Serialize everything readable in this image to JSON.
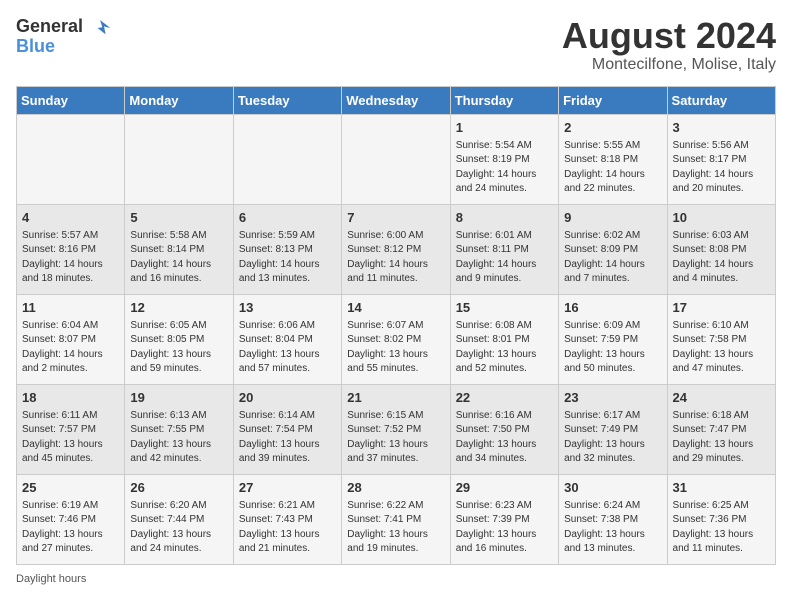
{
  "header": {
    "logo": {
      "text_general": "General",
      "text_blue": "Blue"
    },
    "title": "August 2024",
    "subtitle": "Montecilfone, Molise, Italy"
  },
  "days_of_week": [
    "Sunday",
    "Monday",
    "Tuesday",
    "Wednesday",
    "Thursday",
    "Friday",
    "Saturday"
  ],
  "weeks": [
    [
      {
        "day": "",
        "info": ""
      },
      {
        "day": "",
        "info": ""
      },
      {
        "day": "",
        "info": ""
      },
      {
        "day": "",
        "info": ""
      },
      {
        "day": "1",
        "info": "Sunrise: 5:54 AM\nSunset: 8:19 PM\nDaylight: 14 hours and 24 minutes."
      },
      {
        "day": "2",
        "info": "Sunrise: 5:55 AM\nSunset: 8:18 PM\nDaylight: 14 hours and 22 minutes."
      },
      {
        "day": "3",
        "info": "Sunrise: 5:56 AM\nSunset: 8:17 PM\nDaylight: 14 hours and 20 minutes."
      }
    ],
    [
      {
        "day": "4",
        "info": "Sunrise: 5:57 AM\nSunset: 8:16 PM\nDaylight: 14 hours and 18 minutes."
      },
      {
        "day": "5",
        "info": "Sunrise: 5:58 AM\nSunset: 8:14 PM\nDaylight: 14 hours and 16 minutes."
      },
      {
        "day": "6",
        "info": "Sunrise: 5:59 AM\nSunset: 8:13 PM\nDaylight: 14 hours and 13 minutes."
      },
      {
        "day": "7",
        "info": "Sunrise: 6:00 AM\nSunset: 8:12 PM\nDaylight: 14 hours and 11 minutes."
      },
      {
        "day": "8",
        "info": "Sunrise: 6:01 AM\nSunset: 8:11 PM\nDaylight: 14 hours and 9 minutes."
      },
      {
        "day": "9",
        "info": "Sunrise: 6:02 AM\nSunset: 8:09 PM\nDaylight: 14 hours and 7 minutes."
      },
      {
        "day": "10",
        "info": "Sunrise: 6:03 AM\nSunset: 8:08 PM\nDaylight: 14 hours and 4 minutes."
      }
    ],
    [
      {
        "day": "11",
        "info": "Sunrise: 6:04 AM\nSunset: 8:07 PM\nDaylight: 14 hours and 2 minutes."
      },
      {
        "day": "12",
        "info": "Sunrise: 6:05 AM\nSunset: 8:05 PM\nDaylight: 13 hours and 59 minutes."
      },
      {
        "day": "13",
        "info": "Sunrise: 6:06 AM\nSunset: 8:04 PM\nDaylight: 13 hours and 57 minutes."
      },
      {
        "day": "14",
        "info": "Sunrise: 6:07 AM\nSunset: 8:02 PM\nDaylight: 13 hours and 55 minutes."
      },
      {
        "day": "15",
        "info": "Sunrise: 6:08 AM\nSunset: 8:01 PM\nDaylight: 13 hours and 52 minutes."
      },
      {
        "day": "16",
        "info": "Sunrise: 6:09 AM\nSunset: 7:59 PM\nDaylight: 13 hours and 50 minutes."
      },
      {
        "day": "17",
        "info": "Sunrise: 6:10 AM\nSunset: 7:58 PM\nDaylight: 13 hours and 47 minutes."
      }
    ],
    [
      {
        "day": "18",
        "info": "Sunrise: 6:11 AM\nSunset: 7:57 PM\nDaylight: 13 hours and 45 minutes."
      },
      {
        "day": "19",
        "info": "Sunrise: 6:13 AM\nSunset: 7:55 PM\nDaylight: 13 hours and 42 minutes."
      },
      {
        "day": "20",
        "info": "Sunrise: 6:14 AM\nSunset: 7:54 PM\nDaylight: 13 hours and 39 minutes."
      },
      {
        "day": "21",
        "info": "Sunrise: 6:15 AM\nSunset: 7:52 PM\nDaylight: 13 hours and 37 minutes."
      },
      {
        "day": "22",
        "info": "Sunrise: 6:16 AM\nSunset: 7:50 PM\nDaylight: 13 hours and 34 minutes."
      },
      {
        "day": "23",
        "info": "Sunrise: 6:17 AM\nSunset: 7:49 PM\nDaylight: 13 hours and 32 minutes."
      },
      {
        "day": "24",
        "info": "Sunrise: 6:18 AM\nSunset: 7:47 PM\nDaylight: 13 hours and 29 minutes."
      }
    ],
    [
      {
        "day": "25",
        "info": "Sunrise: 6:19 AM\nSunset: 7:46 PM\nDaylight: 13 hours and 27 minutes."
      },
      {
        "day": "26",
        "info": "Sunrise: 6:20 AM\nSunset: 7:44 PM\nDaylight: 13 hours and 24 minutes."
      },
      {
        "day": "27",
        "info": "Sunrise: 6:21 AM\nSunset: 7:43 PM\nDaylight: 13 hours and 21 minutes."
      },
      {
        "day": "28",
        "info": "Sunrise: 6:22 AM\nSunset: 7:41 PM\nDaylight: 13 hours and 19 minutes."
      },
      {
        "day": "29",
        "info": "Sunrise: 6:23 AM\nSunset: 7:39 PM\nDaylight: 13 hours and 16 minutes."
      },
      {
        "day": "30",
        "info": "Sunrise: 6:24 AM\nSunset: 7:38 PM\nDaylight: 13 hours and 13 minutes."
      },
      {
        "day": "31",
        "info": "Sunrise: 6:25 AM\nSunset: 7:36 PM\nDaylight: 13 hours and 11 minutes."
      }
    ]
  ],
  "footer": {
    "note": "Daylight hours"
  }
}
